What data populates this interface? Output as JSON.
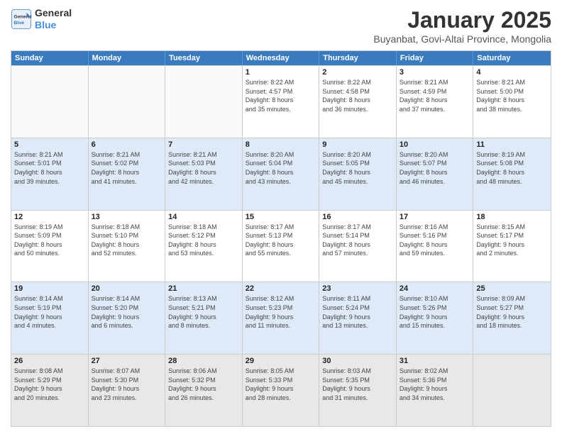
{
  "logo": {
    "line1": "General",
    "line2": "Blue"
  },
  "title": "January 2025",
  "location": "Buyanbat, Govi-Altai Province, Mongolia",
  "days_of_week": [
    "Sunday",
    "Monday",
    "Tuesday",
    "Wednesday",
    "Thursday",
    "Friday",
    "Saturday"
  ],
  "weeks": [
    [
      {
        "day": "",
        "info": ""
      },
      {
        "day": "",
        "info": ""
      },
      {
        "day": "",
        "info": ""
      },
      {
        "day": "1",
        "info": "Sunrise: 8:22 AM\nSunset: 4:57 PM\nDaylight: 8 hours\nand 35 minutes."
      },
      {
        "day": "2",
        "info": "Sunrise: 8:22 AM\nSunset: 4:58 PM\nDaylight: 8 hours\nand 36 minutes."
      },
      {
        "day": "3",
        "info": "Sunrise: 8:21 AM\nSunset: 4:59 PM\nDaylight: 8 hours\nand 37 minutes."
      },
      {
        "day": "4",
        "info": "Sunrise: 8:21 AM\nSunset: 5:00 PM\nDaylight: 8 hours\nand 38 minutes."
      }
    ],
    [
      {
        "day": "5",
        "info": "Sunrise: 8:21 AM\nSunset: 5:01 PM\nDaylight: 8 hours\nand 39 minutes."
      },
      {
        "day": "6",
        "info": "Sunrise: 8:21 AM\nSunset: 5:02 PM\nDaylight: 8 hours\nand 41 minutes."
      },
      {
        "day": "7",
        "info": "Sunrise: 8:21 AM\nSunset: 5:03 PM\nDaylight: 8 hours\nand 42 minutes."
      },
      {
        "day": "8",
        "info": "Sunrise: 8:20 AM\nSunset: 5:04 PM\nDaylight: 8 hours\nand 43 minutes."
      },
      {
        "day": "9",
        "info": "Sunrise: 8:20 AM\nSunset: 5:05 PM\nDaylight: 8 hours\nand 45 minutes."
      },
      {
        "day": "10",
        "info": "Sunrise: 8:20 AM\nSunset: 5:07 PM\nDaylight: 8 hours\nand 46 minutes."
      },
      {
        "day": "11",
        "info": "Sunrise: 8:19 AM\nSunset: 5:08 PM\nDaylight: 8 hours\nand 48 minutes."
      }
    ],
    [
      {
        "day": "12",
        "info": "Sunrise: 8:19 AM\nSunset: 5:09 PM\nDaylight: 8 hours\nand 50 minutes."
      },
      {
        "day": "13",
        "info": "Sunrise: 8:18 AM\nSunset: 5:10 PM\nDaylight: 8 hours\nand 52 minutes."
      },
      {
        "day": "14",
        "info": "Sunrise: 8:18 AM\nSunset: 5:12 PM\nDaylight: 8 hours\nand 53 minutes."
      },
      {
        "day": "15",
        "info": "Sunrise: 8:17 AM\nSunset: 5:13 PM\nDaylight: 8 hours\nand 55 minutes."
      },
      {
        "day": "16",
        "info": "Sunrise: 8:17 AM\nSunset: 5:14 PM\nDaylight: 8 hours\nand 57 minutes."
      },
      {
        "day": "17",
        "info": "Sunrise: 8:16 AM\nSunset: 5:16 PM\nDaylight: 8 hours\nand 59 minutes."
      },
      {
        "day": "18",
        "info": "Sunrise: 8:15 AM\nSunset: 5:17 PM\nDaylight: 9 hours\nand 2 minutes."
      }
    ],
    [
      {
        "day": "19",
        "info": "Sunrise: 8:14 AM\nSunset: 5:19 PM\nDaylight: 9 hours\nand 4 minutes."
      },
      {
        "day": "20",
        "info": "Sunrise: 8:14 AM\nSunset: 5:20 PM\nDaylight: 9 hours\nand 6 minutes."
      },
      {
        "day": "21",
        "info": "Sunrise: 8:13 AM\nSunset: 5:21 PM\nDaylight: 9 hours\nand 8 minutes."
      },
      {
        "day": "22",
        "info": "Sunrise: 8:12 AM\nSunset: 5:23 PM\nDaylight: 9 hours\nand 11 minutes."
      },
      {
        "day": "23",
        "info": "Sunrise: 8:11 AM\nSunset: 5:24 PM\nDaylight: 9 hours\nand 13 minutes."
      },
      {
        "day": "24",
        "info": "Sunrise: 8:10 AM\nSunset: 5:26 PM\nDaylight: 9 hours\nand 15 minutes."
      },
      {
        "day": "25",
        "info": "Sunrise: 8:09 AM\nSunset: 5:27 PM\nDaylight: 9 hours\nand 18 minutes."
      }
    ],
    [
      {
        "day": "26",
        "info": "Sunrise: 8:08 AM\nSunset: 5:29 PM\nDaylight: 9 hours\nand 20 minutes."
      },
      {
        "day": "27",
        "info": "Sunrise: 8:07 AM\nSunset: 5:30 PM\nDaylight: 9 hours\nand 23 minutes."
      },
      {
        "day": "28",
        "info": "Sunrise: 8:06 AM\nSunset: 5:32 PM\nDaylight: 9 hours\nand 26 minutes."
      },
      {
        "day": "29",
        "info": "Sunrise: 8:05 AM\nSunset: 5:33 PM\nDaylight: 9 hours\nand 28 minutes."
      },
      {
        "day": "30",
        "info": "Sunrise: 8:03 AM\nSunset: 5:35 PM\nDaylight: 9 hours\nand 31 minutes."
      },
      {
        "day": "31",
        "info": "Sunrise: 8:02 AM\nSunset: 5:36 PM\nDaylight: 9 hours\nand 34 minutes."
      },
      {
        "day": "",
        "info": ""
      }
    ]
  ]
}
